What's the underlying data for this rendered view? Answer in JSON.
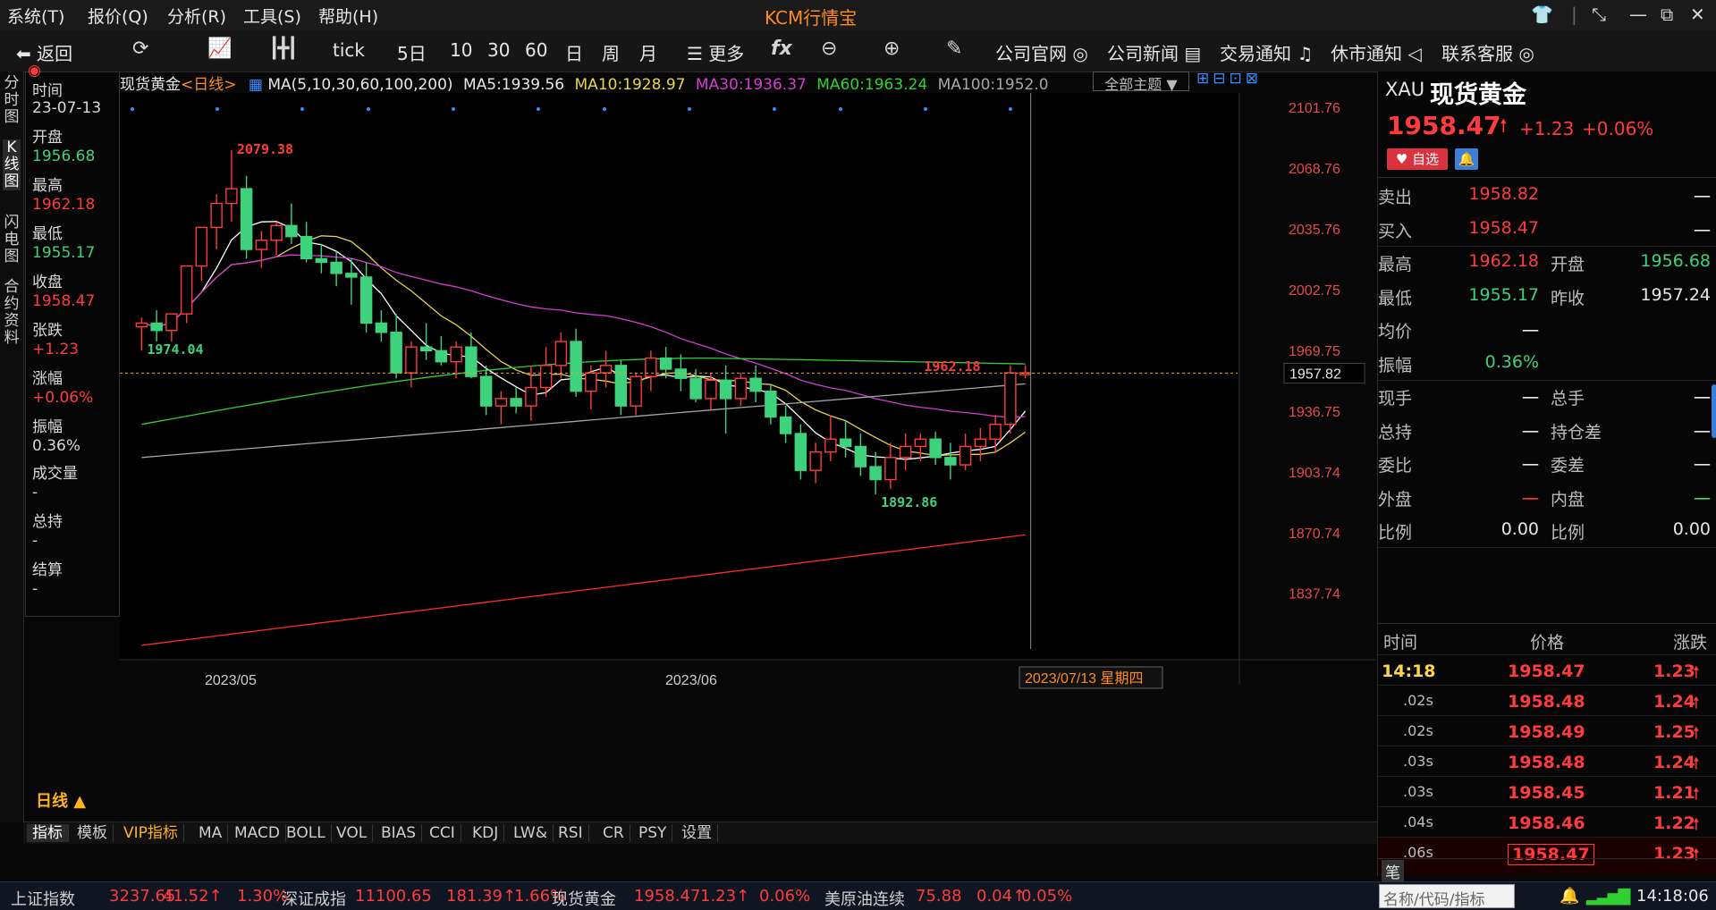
{
  "menu": [
    "系统(T)",
    "报价(Q)",
    "分析(R)",
    "工具(S)",
    "帮助(H)"
  ],
  "app_title": "KCM行情宝",
  "toolbar": {
    "back": "返回",
    "tick": "tick",
    "periods": [
      "5日",
      "10",
      "30",
      "60",
      "日",
      "周",
      "月"
    ],
    "more": "更多",
    "links": [
      "公司官网",
      "公司新闻",
      "交易通知",
      "休市通知",
      "联系客服"
    ]
  },
  "vtabs": [
    "分时图",
    "K线图",
    "闪电图",
    "合约资料"
  ],
  "info_panel": {
    "time_label": "时间",
    "time": "23-07-13",
    "open_label": "开盘",
    "open": "1956.68",
    "high_label": "最高",
    "high": "1962.18",
    "low_label": "最低",
    "low": "1955.17",
    "close_label": "收盘",
    "close": "1958.47",
    "change_label": "张跌",
    "change": "+1.23",
    "pct_label": "涨幅",
    "pct": "+0.06%",
    "amp_label": "振幅",
    "amp": "0.36%",
    "vol_label": "成交量",
    "vol": "-",
    "oi_label": "总持",
    "oi": "-",
    "settle_label": "结算",
    "settle": "-"
  },
  "chart_header": {
    "name": "现货黄金",
    "period": "<日线>",
    "ma_def": "MA(5,10,30,60,100,200)",
    "ma5": "MA5:1939.56",
    "ma10": "MA10:1928.97",
    "ma30": "MA30:1936.37",
    "ma60": "MA60:1963.24",
    "ma100": "MA100:1952.0",
    "theme": "全部主题"
  },
  "colors": {
    "up": "#ff3b3b",
    "down": "#3ed27d",
    "ma5": "#ffffff",
    "ma10": "#e8d44a",
    "ma30": "#d63bd6",
    "ma60": "#2fd02f",
    "ma100": "#a6a6a6",
    "ma200": "#ff2a2a"
  },
  "chart_data": {
    "type": "candlestick",
    "y_ticks": [
      "2101.76",
      "2068.76",
      "2035.76",
      "2002.75",
      "1969.75",
      "1936.75",
      "1903.74",
      "1870.74",
      "1837.74"
    ],
    "ylim": [
      1808,
      2110
    ],
    "x_ticks": [
      "2023/05",
      "2023/06"
    ],
    "current_price_label": "1957.82",
    "current_price": 1957.82,
    "annotations": {
      "high": "2079.38",
      "start_low": "1974.04",
      "low": "1892.86",
      "last_high": "1962.18"
    },
    "crosshair_date": "2023/07/13 星期四",
    "period_label": "日线",
    "candles": [
      [
        1983,
        1988,
        1970,
        1985
      ],
      [
        1985,
        1992,
        1975,
        1981
      ],
      [
        1981,
        1990,
        1975,
        1990
      ],
      [
        1990,
        2005,
        1985,
        2016
      ],
      [
        2016,
        2032,
        2008,
        2037
      ],
      [
        2037,
        2055,
        2025,
        2050
      ],
      [
        2050,
        2079,
        2040,
        2058
      ],
      [
        2058,
        2065,
        2020,
        2025
      ],
      [
        2025,
        2035,
        2015,
        2030
      ],
      [
        2030,
        2040,
        2022,
        2038
      ],
      [
        2038,
        2050,
        2028,
        2032
      ],
      [
        2032,
        2040,
        2018,
        2020
      ],
      [
        2020,
        2028,
        2012,
        2018
      ],
      [
        2018,
        2024,
        2005,
        2012
      ],
      [
        2012,
        2020,
        1995,
        2010
      ],
      [
        2010,
        2018,
        1980,
        1985
      ],
      [
        1985,
        1992,
        1975,
        1980
      ],
      [
        1980,
        1990,
        1955,
        1958
      ],
      [
        1958,
        1975,
        1950,
        1972
      ],
      [
        1972,
        1985,
        1965,
        1970
      ],
      [
        1970,
        1978,
        1962,
        1964
      ],
      [
        1964,
        1975,
        1955,
        1972
      ],
      [
        1972,
        1980,
        1955,
        1956
      ],
      [
        1956,
        1962,
        1935,
        1940
      ],
      [
        1940,
        1948,
        1930,
        1944
      ],
      [
        1944,
        1950,
        1936,
        1940
      ],
      [
        1940,
        1962,
        1932,
        1950
      ],
      [
        1950,
        1972,
        1945,
        1962
      ],
      [
        1962,
        1980,
        1955,
        1975
      ],
      [
        1975,
        1982,
        1945,
        1948
      ],
      [
        1948,
        1962,
        1938,
        1958
      ],
      [
        1958,
        1970,
        1950,
        1962
      ],
      [
        1962,
        1965,
        1935,
        1940
      ],
      [
        1940,
        1958,
        1935,
        1956
      ],
      [
        1956,
        1970,
        1948,
        1966
      ],
      [
        1966,
        1972,
        1955,
        1960
      ],
      [
        1960,
        1968,
        1948,
        1955
      ],
      [
        1955,
        1960,
        1942,
        1944
      ],
      [
        1944,
        1958,
        1938,
        1954
      ],
      [
        1954,
        1962,
        1925,
        1944
      ],
      [
        1944,
        1958,
        1940,
        1955
      ],
      [
        1955,
        1962,
        1942,
        1948
      ],
      [
        1948,
        1952,
        1930,
        1934
      ],
      [
        1934,
        1940,
        1920,
        1925
      ],
      [
        1925,
        1930,
        1900,
        1905
      ],
      [
        1905,
        1920,
        1898,
        1915
      ],
      [
        1915,
        1935,
        1910,
        1922
      ],
      [
        1922,
        1932,
        1912,
        1918
      ],
      [
        1918,
        1925,
        1902,
        1907
      ],
      [
        1907,
        1915,
        1892,
        1900
      ],
      [
        1900,
        1920,
        1895,
        1912
      ],
      [
        1912,
        1925,
        1905,
        1918
      ],
      [
        1918,
        1925,
        1910,
        1922
      ],
      [
        1922,
        1926,
        1908,
        1912
      ],
      [
        1912,
        1920,
        1900,
        1908
      ],
      [
        1908,
        1925,
        1905,
        1918
      ],
      [
        1918,
        1928,
        1910,
        1922
      ],
      [
        1922,
        1935,
        1915,
        1930
      ],
      [
        1930,
        1962,
        1925,
        1958
      ],
      [
        1957,
        1962,
        1955,
        1958
      ]
    ]
  },
  "right_panel": {
    "symbol": "XAU",
    "name": "现货黄金",
    "price": "1958.47",
    "change": "+1.23",
    "pct": "+0.06%",
    "fav": "自选",
    "rows": [
      {
        "l1": "卖出",
        "v1": "1958.82",
        "c1": "red",
        "v2": "一"
      },
      {
        "l1": "买入",
        "v1": "1958.47",
        "c1": "red",
        "v2": "一"
      },
      {
        "l1": "最高",
        "v1": "1962.18",
        "c1": "red",
        "l2": "开盘",
        "v2": "1956.68",
        "c2": "green"
      },
      {
        "l1": "最低",
        "v1": "1955.17",
        "c1": "green",
        "l2": "昨收",
        "v2": "1957.24",
        "c2": "white"
      },
      {
        "l1": "均价",
        "v1": "一",
        "c1": "white"
      },
      {
        "l1": "振幅",
        "v1": "0.36%",
        "c1": "green"
      },
      {
        "l1": "现手",
        "v1": "一",
        "c1": "white",
        "l2": "总手",
        "v2": "一",
        "c2": "white"
      },
      {
        "l1": "总持",
        "v1": "一",
        "c1": "white",
        "l2": "持仓差",
        "v2": "一",
        "c2": "white"
      },
      {
        "l1": "委比",
        "v1": "一",
        "c1": "white",
        "l2": "委差",
        "v2": "一",
        "c2": "white"
      },
      {
        "l1": "外盘",
        "v1": "一",
        "c1": "red",
        "l2": "内盘",
        "v2": "一",
        "c2": "green"
      },
      {
        "l1": "比例",
        "v1": "0.00",
        "c1": "white",
        "l2": "比例",
        "v2": "0.00",
        "c2": "white"
      }
    ],
    "ticks_header": {
      "time": "时间",
      "price": "价格",
      "chg": "涨跌"
    },
    "ticks": [
      {
        "t": "14:18",
        "p": "1958.47",
        "c": "1.23"
      },
      {
        "t": ".02s",
        "p": "1958.48",
        "c": "1.24"
      },
      {
        "t": ".02s",
        "p": "1958.49",
        "c": "1.25"
      },
      {
        "t": ".03s",
        "p": "1958.48",
        "c": "1.24"
      },
      {
        "t": ".03s",
        "p": "1958.45",
        "c": "1.21"
      },
      {
        "t": ".04s",
        "p": "1958.46",
        "c": "1.22"
      },
      {
        "t": ".06s",
        "p": "1958.47",
        "c": "1.23"
      }
    ],
    "pen": "笔",
    "search_placeholder": "名称/代码/指标",
    "clock": "14:18:06"
  },
  "indicator_tabs": [
    "指标",
    "模板",
    "VIP指标",
    "MA",
    "MACD",
    "BOLL",
    "VOL",
    "BIAS",
    "CCI",
    "KDJ",
    "LW&",
    "RSI",
    "CR",
    "PSY",
    "设置"
  ],
  "statusbar": [
    {
      "name": "上证指数",
      "v": "3237.65",
      "c": "41.52↑",
      "p": "1.30%"
    },
    {
      "name": "深证成指",
      "v": "11100.65",
      "c": "181.39↑",
      "p": "1.66%"
    },
    {
      "name": "现货黄金",
      "v": "1958.47",
      "c": "1.23↑",
      "p": "0.06%"
    },
    {
      "name": "美原油连续",
      "v": "75.88",
      "c": "0.04↑",
      "p": "0.05%"
    }
  ]
}
